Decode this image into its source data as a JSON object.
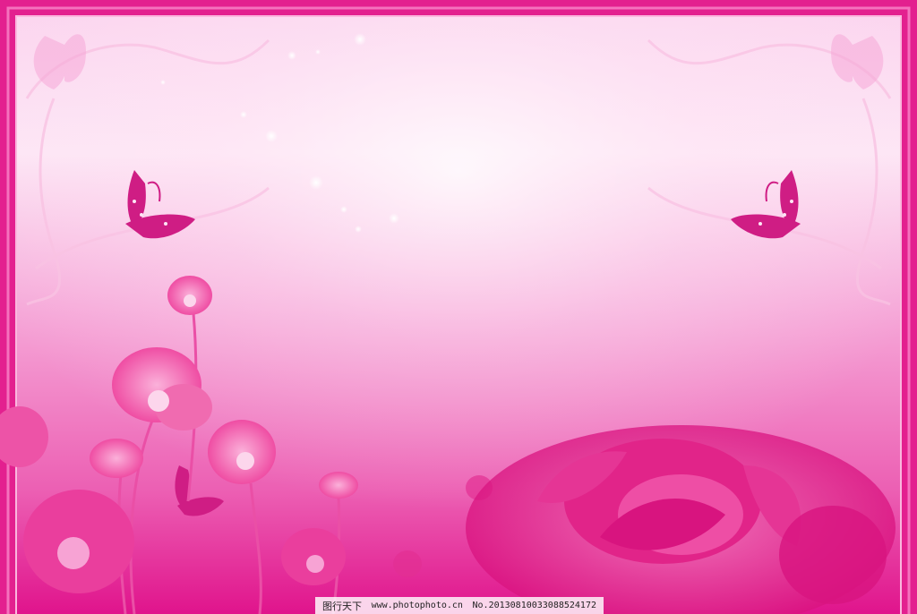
{
  "watermark": {
    "site_name": "图行天下",
    "url": "www.photophoto.cn",
    "serial": "No.20130810033088524172"
  },
  "palette": {
    "frame": "#e41e93",
    "top_glow": "#ffe6f5",
    "mid_pink": "#f5a8d8",
    "deep_pink": "#e0148c",
    "flower": "#f0569f",
    "butterfly": "#c8147a"
  },
  "icons": [
    "butterfly-icon",
    "poppy-flower-icon",
    "rose-flower-icon",
    "swirl-vine-icon"
  ]
}
